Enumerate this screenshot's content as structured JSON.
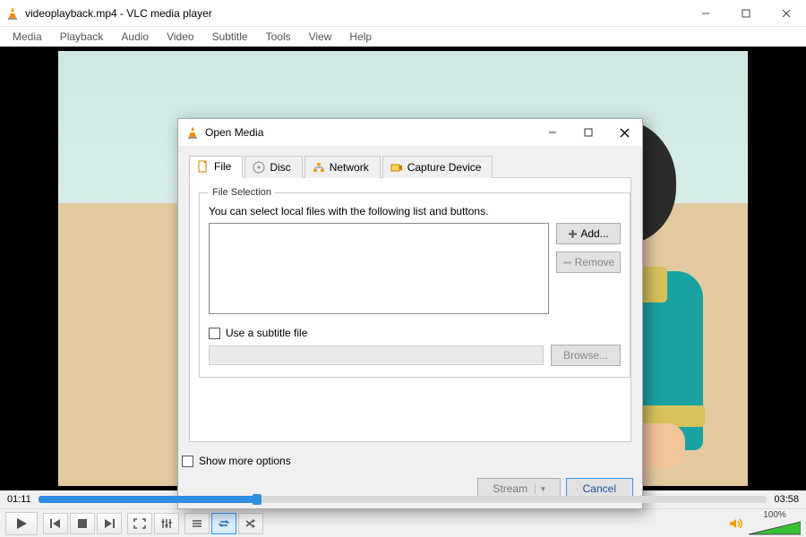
{
  "window": {
    "title": "videoplayback.mp4 - VLC media player"
  },
  "menu": [
    "Media",
    "Playback",
    "Audio",
    "Video",
    "Subtitle",
    "Tools",
    "View",
    "Help"
  ],
  "dialog": {
    "title": "Open Media",
    "tabs": [
      {
        "label": "File",
        "active": true
      },
      {
        "label": "Disc",
        "active": false
      },
      {
        "label": "Network",
        "active": false
      },
      {
        "label": "Capture Device",
        "active": false
      }
    ],
    "file_selection": {
      "legend": "File Selection",
      "hint": "You can select local files with the following list and buttons.",
      "add_label": "Add...",
      "remove_label": "Remove"
    },
    "subtitle": {
      "checkbox_label": "Use a subtitle file",
      "browse_label": "Browse..."
    },
    "more_options_label": "Show more options",
    "footer": {
      "stream_label": "Stream",
      "cancel_label": "Cancel"
    }
  },
  "player": {
    "elapsed": "01:11",
    "total": "03:58",
    "progress_percent": 30,
    "volume_percent_label": "100%",
    "volume_percent": 100
  }
}
